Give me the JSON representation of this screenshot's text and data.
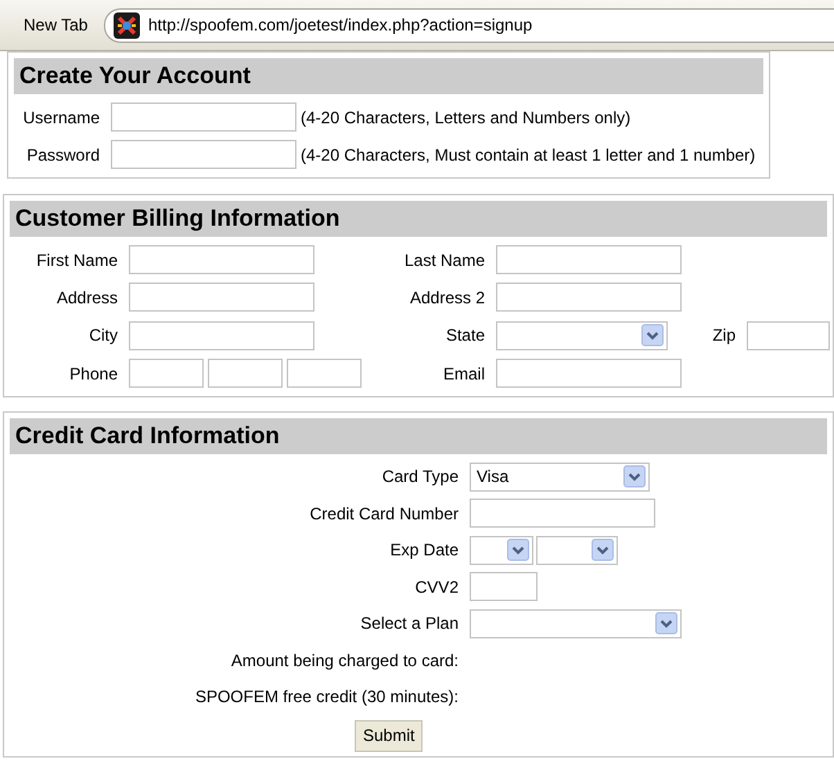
{
  "browser": {
    "tab_label": "New Tab",
    "url": "http://spoofem.com/joetest/index.php?action=signup"
  },
  "account": {
    "title": "Create Your Account",
    "fields": [
      {
        "label": "Username",
        "hint": "(4-20 Characters, Letters and Numbers only)"
      },
      {
        "label": "Password",
        "hint": "(4-20 Characters, Must contain at least 1 letter and 1 number)"
      }
    ]
  },
  "billing": {
    "title": "Customer Billing Information",
    "rows": [
      [
        {
          "label": "First Name",
          "kind": "text"
        },
        {
          "label": "Last Name",
          "kind": "text"
        }
      ],
      [
        {
          "label": "Address",
          "kind": "text"
        },
        {
          "label": "Address 2",
          "kind": "text"
        }
      ],
      [
        {
          "label": "City",
          "kind": "text"
        },
        {
          "label": "State",
          "kind": "select"
        },
        {
          "label": "Zip",
          "kind": "short"
        }
      ],
      [
        {
          "label": "Phone",
          "kind": "phone"
        },
        {
          "label": "Email",
          "kind": "text"
        }
      ]
    ]
  },
  "credit_card": {
    "title": "Credit Card Information",
    "rows": [
      {
        "label": "Card Type",
        "kind": "select",
        "value": "Visa"
      },
      {
        "label": "Credit Card Number",
        "kind": "text"
      },
      {
        "label": "Exp Date",
        "kind": "date"
      },
      {
        "label": "CVV2",
        "kind": "short"
      },
      {
        "label": "Select a Plan",
        "kind": "wide_select"
      },
      {
        "label": "Amount being charged to card:",
        "kind": "info"
      },
      {
        "label": "SPOOFEM free credit (30 minutes):",
        "kind": "info"
      }
    ],
    "submit": "Submit"
  }
}
